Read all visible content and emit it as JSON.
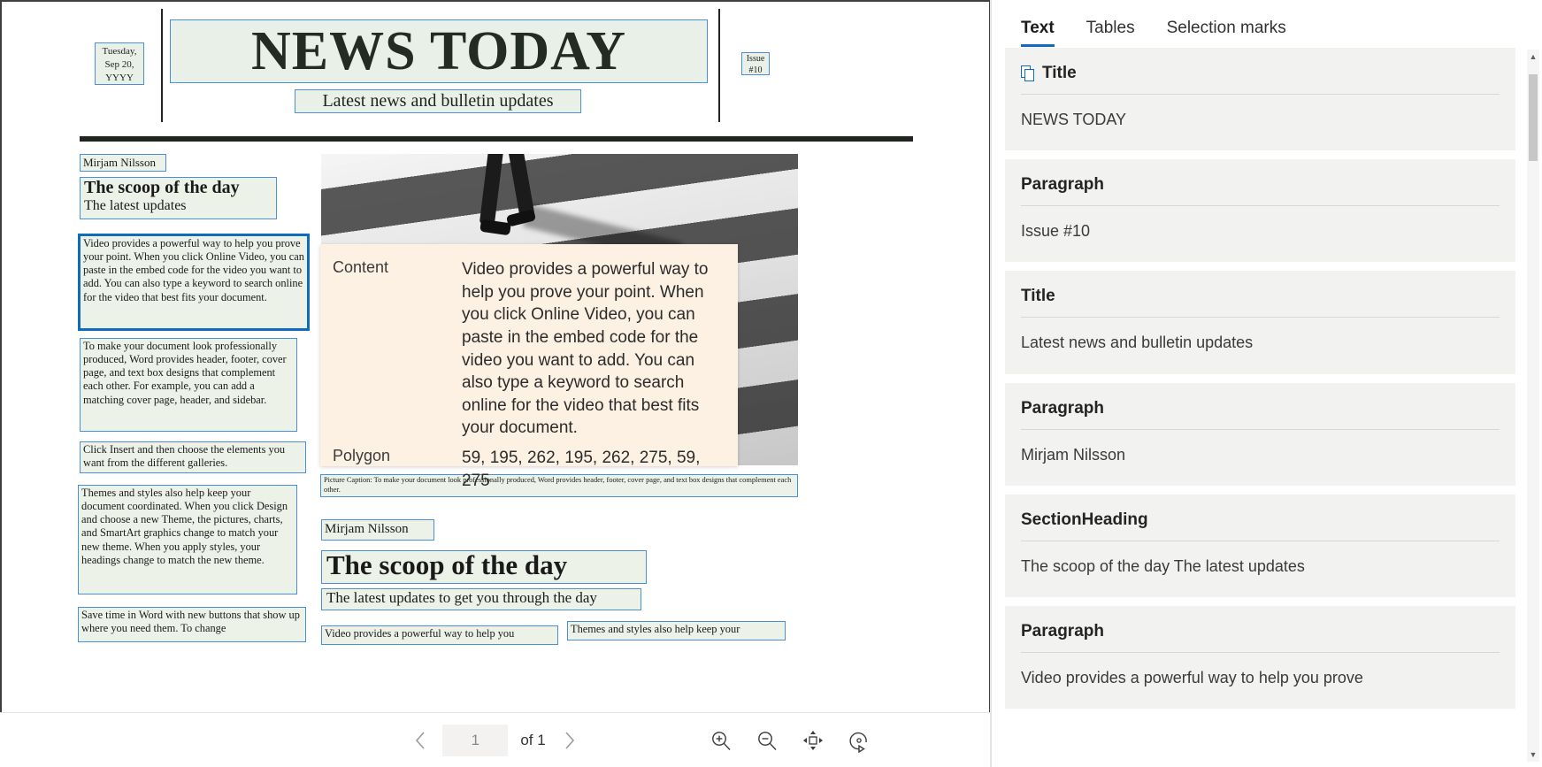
{
  "document": {
    "masthead": "NEWS TODAY",
    "subhead": "Latest news and bulletin updates",
    "date_line1": "Tuesday,",
    "date_line2": "Sep 20,",
    "date_line3": "YYYY",
    "issue_line1": "Issue",
    "issue_line2": "#10",
    "byline_top": "Mirjam Nilsson",
    "headline_top": "The scoop of the day",
    "subheadline_top": "The latest updates",
    "para1": "Video provides a powerful way to help you prove your point. When you click Online Video, you can paste in the embed code for the video you want to add. You can also type a keyword to search online for the video that best fits your document.",
    "para2": "To make your document look professionally produced, Word provides header, footer, cover page, and text box designs that complement each other. For example, you can add a matching cover page, header, and sidebar.",
    "para3": "Click Insert and then choose the elements you want from the different galleries.",
    "para4": "Themes and styles also help keep your document coordinated. When you click Design and choose a new Theme, the pictures, charts, and SmartArt graphics change to match your new theme. When you apply styles, your headings change to match the new theme.",
    "para5": "Save time in Word with new buttons that show up where you need them. To change",
    "caption": "Picture Caption: To make your document look professionally produced, Word provides header, footer, cover page, and text box designs that complement each other.",
    "byline_bottom": "Mirjam Nilsson",
    "headline_bottom": "The scoop of the day",
    "subheadline_bottom": "The latest updates to get you through the day",
    "col_bottom_left": "Video provides a powerful way to help you",
    "col_bottom_right": "Themes and styles also help keep your"
  },
  "callout": {
    "content_label": "Content",
    "content_value": "Video provides a powerful way to help you prove your point. When you click Online Video, you can paste in the embed code for the video you want to add. You can also type a keyword to search online for the video that best fits your document.",
    "polygon_label": "Polygon",
    "polygon_value": "59, 195, 262, 195, 262, 275, 59, 275",
    "background_color": "#fdf1e3"
  },
  "toolbar": {
    "prev_icon": "chevron-left-icon",
    "next_icon": "chevron-right-icon",
    "page_value": "1",
    "page_total": "of 1",
    "zoom_in_icon": "zoom-in-icon",
    "zoom_out_icon": "zoom-out-icon",
    "fit_page_icon": "fit-to-page-icon",
    "rotate_icon": "rotate-icon"
  },
  "panel": {
    "tabs": [
      {
        "label": "Text",
        "active": true
      },
      {
        "label": "Tables",
        "active": false
      },
      {
        "label": "Selection marks",
        "active": false
      }
    ],
    "accent_color": "#0f6cbd",
    "cards": [
      {
        "type": "Title",
        "icon": "pages-icon",
        "value": "NEWS TODAY"
      },
      {
        "type": "Paragraph",
        "icon": "",
        "value": "Issue #10"
      },
      {
        "type": "Title",
        "icon": "",
        "value": "Latest news and bulletin updates"
      },
      {
        "type": "Paragraph",
        "icon": "",
        "value": "Mirjam Nilsson"
      },
      {
        "type": "SectionHeading",
        "icon": "",
        "value": "The scoop of the day The latest updates"
      },
      {
        "type": "Paragraph",
        "icon": "",
        "value": "Video provides a powerful way to help you prove"
      }
    ]
  }
}
